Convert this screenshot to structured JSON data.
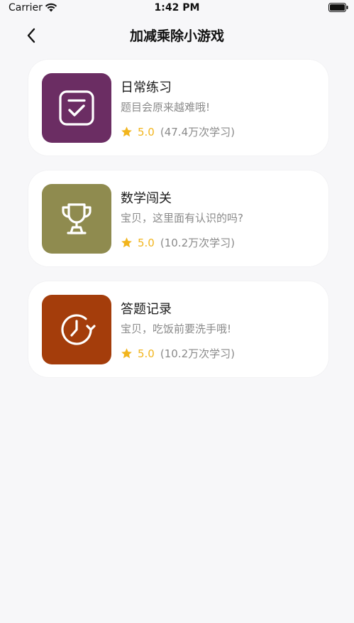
{
  "status_bar": {
    "carrier": "Carrier",
    "time": "1:42 PM"
  },
  "nav": {
    "title": "加减乘除小游戏",
    "back_icon": "chevron-left-icon"
  },
  "colors": {
    "background": "#f7f7f9",
    "rating": "#f2b51d",
    "subtitle": "#8a8a8a"
  },
  "cards": [
    {
      "title": "日常练习",
      "subtitle": "题目会原来越难哦!",
      "rating": "5.0",
      "count": "(47.4万次学习)",
      "icon": "checklist-icon",
      "color": "#6b2d63"
    },
    {
      "title": "数学闯关",
      "subtitle": "宝贝，这里面有认识的吗?",
      "rating": "5.0",
      "count": "(10.2万次学习)",
      "icon": "trophy-icon",
      "color": "#8f8b4f"
    },
    {
      "title": "答题记录",
      "subtitle": "宝贝，吃饭前要洗手哦!",
      "rating": "5.0",
      "count": "(10.2万次学习)",
      "icon": "history-clock-icon",
      "color": "#a43d0b"
    }
  ]
}
